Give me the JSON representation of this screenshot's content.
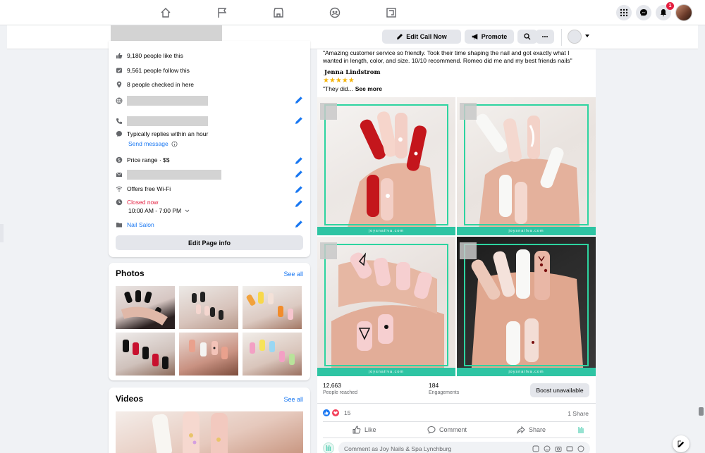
{
  "nav": {
    "icons": [
      "home-icon",
      "flag-icon",
      "marketplace-icon",
      "groups-icon",
      "gaming-icon"
    ],
    "notification_count": "1"
  },
  "header": {
    "edit_call": "Edit Call Now",
    "promote": "Promote"
  },
  "about": {
    "likes": "9,180 people like this",
    "follows": "9,561 people follow this",
    "checkins": "8 people checked in here",
    "replies": "Typically replies within an hour",
    "send_message": "Send message",
    "price": "Price range · $$",
    "wifi": "Offers free Wi-Fi",
    "closed": "Closed now",
    "hours": "10:00 AM - 7:00 PM",
    "category": "Nail Salon",
    "edit_info": "Edit Page info"
  },
  "photos": {
    "title": "Photos",
    "see_all": "See all"
  },
  "videos": {
    "title": "Videos",
    "see_all": "See all"
  },
  "post": {
    "quote": "\"Amazing customer service so friendly. Took their time shaping the nail and got exactly what I wanted in length, color, and size. 10/10 recommend. Romeo did me and my best friends nails\"",
    "author": "Jenna Lindstrom",
    "stars": "★★★★★",
    "they_did": "\"They did...",
    "see_more": "See more",
    "watermark": "joysnailva.com",
    "reached_value": "12,663",
    "reached_label": "People reached",
    "engagements_value": "184",
    "engagements_label": "Engagements",
    "boost": "Boost unavailable",
    "reactions_count": "15",
    "shares": "1 Share",
    "like": "Like",
    "comment": "Comment",
    "share": "Share",
    "comment_placeholder": "Comment as Joy Nails & Spa Lynchburg"
  },
  "colors": {
    "accent": "#1877f2",
    "banner": "#2ec4a3",
    "closed": "#e41e3f"
  }
}
